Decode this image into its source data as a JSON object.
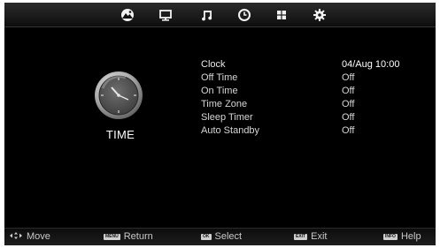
{
  "tabs": [
    {
      "icon": "picture-icon"
    },
    {
      "icon": "screen-icon"
    },
    {
      "icon": "music-icon"
    },
    {
      "icon": "clock-icon",
      "selected": true
    },
    {
      "icon": "grid-icon"
    },
    {
      "icon": "gear-icon"
    }
  ],
  "section": {
    "title": "TIME",
    "icon": "analog-clock-icon"
  },
  "menu": {
    "items": [
      {
        "label": "Clock",
        "value": "04/Aug 10:00"
      },
      {
        "label": "Off Time",
        "value": "Off"
      },
      {
        "label": "On Time",
        "value": "Off"
      },
      {
        "label": "Time Zone",
        "value": "Off"
      },
      {
        "label": "Sleep Timer",
        "value": "Off"
      },
      {
        "label": "Auto Standby",
        "value": "Off"
      }
    ]
  },
  "hints": {
    "move": {
      "label": "Move"
    },
    "return": {
      "key": "MENU",
      "label": "Return"
    },
    "select": {
      "key": "OK",
      "label": "Select"
    },
    "exit": {
      "key": "EXIT",
      "label": "Exit"
    },
    "help": {
      "key": "INFO",
      "label": "Help"
    }
  },
  "colors": {
    "background": "#000000",
    "text": "#d6d6d6",
    "accent": "#ffffff"
  }
}
